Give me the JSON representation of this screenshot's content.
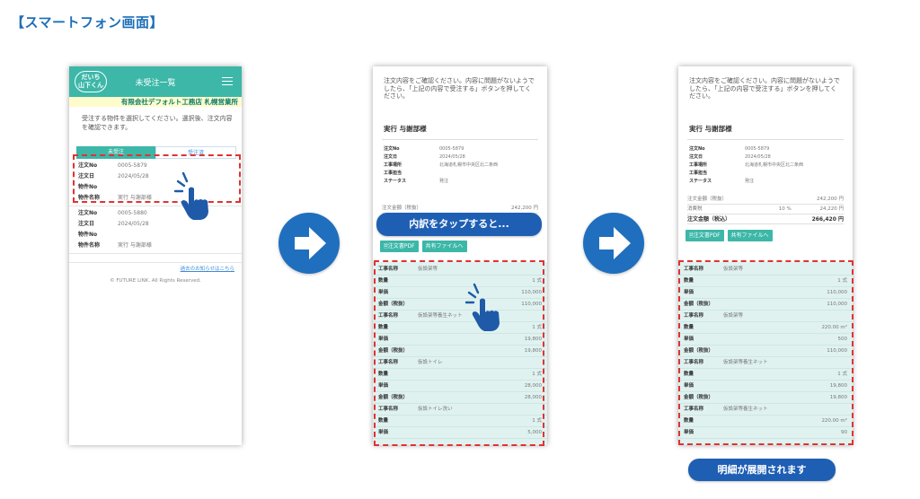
{
  "heading": "【スマートフォン画面】",
  "phone1": {
    "logo": "だいち\n山下くん",
    "title": "未受注一覧",
    "company": "有限会社デフォルト工務店 札幌営業所",
    "intro": "受注する物件を選択してください。選択後、注文内容を確認できます。",
    "tabs": [
      "未受注",
      "受注済"
    ],
    "orders": [
      [
        {
          "k": "注文No",
          "v": "0005-5879"
        },
        {
          "k": "注文日",
          "v": "2024/05/28"
        },
        {
          "k": "物件No",
          "v": ""
        },
        {
          "k": "物件名称",
          "v": "実行 与謝部様"
        }
      ],
      [
        {
          "k": "注文No",
          "v": "0005-5880"
        },
        {
          "k": "注文日",
          "v": "2024/05/28"
        },
        {
          "k": "物件No",
          "v": ""
        },
        {
          "k": "物件名称",
          "v": "実行 与謝部様"
        }
      ]
    ],
    "link": "過去のお知らせはこちら",
    "copyright": "© FUTURE LINK. All Rights Reserved."
  },
  "confirm": {
    "text": "注文内容をご確認ください。内容に問題がないようでしたら、「上記の内容で受注する」ボタンを押してください。",
    "title": "実行 与謝部様",
    "details": [
      {
        "k": "注文No",
        "v": "0005-5879"
      },
      {
        "k": "注文日",
        "v": "2024/05/28"
      },
      {
        "k": "工事場所",
        "v": "北海道札幌市中央区北二条西"
      },
      {
        "k": "工事担当",
        "v": ""
      },
      {
        "k": "ステータス",
        "v": "発注"
      }
    ],
    "btn_pdf": "注文書PDF",
    "btn_share": "共有ファイルへ"
  },
  "phone2": {
    "subtotal_label": "注文金額（税抜）",
    "subtotal_value": "242,200 円",
    "items": [
      {
        "k": "工事名称",
        "n": "仮設架等",
        "v": ""
      },
      {
        "k": "数量",
        "n": "",
        "v": "1 式"
      },
      {
        "k": "単価",
        "n": "",
        "v": "110,000"
      },
      {
        "k": "金額（税抜）",
        "n": "",
        "v": "110,000"
      },
      {
        "k": "工事名称",
        "n": "仮設架等養生ネット",
        "v": ""
      },
      {
        "k": "数量",
        "n": "",
        "v": "1 式"
      },
      {
        "k": "単価",
        "n": "",
        "v": "19,800"
      },
      {
        "k": "金額（税抜）",
        "n": "",
        "v": "19,800"
      },
      {
        "k": "工事名称",
        "n": "仮設トイレ",
        "v": ""
      },
      {
        "k": "数量",
        "n": "",
        "v": "1 式"
      },
      {
        "k": "単価",
        "n": "",
        "v": "28,000"
      },
      {
        "k": "金額（税抜）",
        "n": "",
        "v": "28,000"
      },
      {
        "k": "工事名称",
        "n": "仮設トイレ洗い",
        "v": ""
      },
      {
        "k": "数量",
        "n": "",
        "v": "1 式"
      },
      {
        "k": "単価",
        "n": "",
        "v": "5,000"
      }
    ]
  },
  "phone3": {
    "totals": [
      {
        "k": "注文金額（税抜）",
        "m": "",
        "v": "242,200 円"
      },
      {
        "k": "消費税",
        "m": "10 %",
        "v": "24,220 円"
      },
      {
        "k": "注文金額（税込）",
        "m": "",
        "v": "266,420 円"
      }
    ],
    "items": [
      {
        "k": "工事名称",
        "n": "仮設架等",
        "v": ""
      },
      {
        "k": "数量",
        "n": "",
        "v": "1 式"
      },
      {
        "k": "単価",
        "n": "",
        "v": "110,000"
      },
      {
        "k": "金額（税抜）",
        "n": "",
        "v": "110,000"
      },
      {
        "k": "工事名称",
        "n": "仮設架等",
        "v": ""
      },
      {
        "k": "数量",
        "n": "",
        "v": "220.00 m²"
      },
      {
        "k": "単価",
        "n": "",
        "v": "500"
      },
      {
        "k": "金額（税抜）",
        "n": "",
        "v": "110,000"
      },
      {
        "k": "工事名称",
        "n": "仮設架等養生ネット",
        "v": ""
      },
      {
        "k": "数量",
        "n": "",
        "v": "1 式"
      },
      {
        "k": "単価",
        "n": "",
        "v": "19,800"
      },
      {
        "k": "金額（税抜）",
        "n": "",
        "v": "19,800"
      },
      {
        "k": "工事名称",
        "n": "仮設架等養生ネット",
        "v": ""
      },
      {
        "k": "数量",
        "n": "",
        "v": "220.00 m²"
      },
      {
        "k": "単価",
        "n": "",
        "v": "90"
      }
    ]
  },
  "callouts": {
    "tap_hint": "内訳をタップすると...",
    "expanded": "明細が展開されます"
  },
  "colors": {
    "teal": "#3cb7a8",
    "blue": "#1e5fb4",
    "dash_red": "#e03232",
    "item_bg": "#dff2f0"
  }
}
